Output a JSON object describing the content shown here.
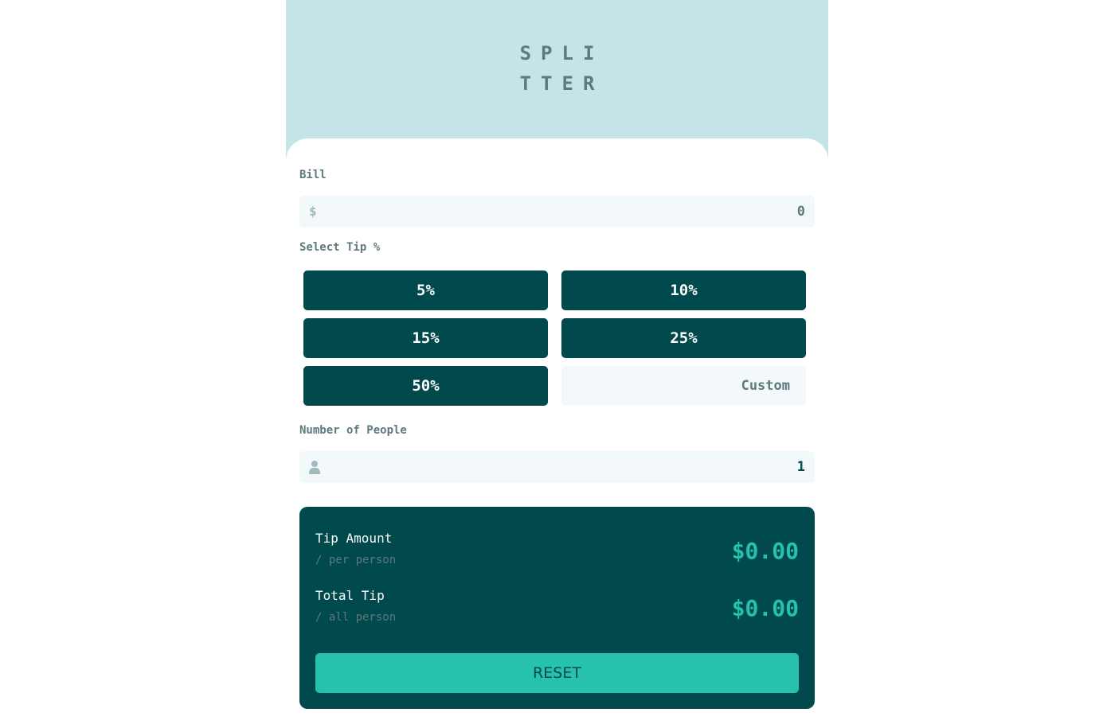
{
  "logo": {
    "line1": "SPLI",
    "line2": "TTER"
  },
  "bill": {
    "label": "Bill",
    "currency_icon": "$",
    "value": "0"
  },
  "tip": {
    "label": "Select Tip %",
    "options": [
      "5%",
      "10%",
      "15%",
      "25%",
      "50%"
    ],
    "custom_placeholder": "Custom"
  },
  "people": {
    "label": "Number of People",
    "icon": "person-icon",
    "value": "1"
  },
  "results": {
    "tip_amount_title": "Tip Amount",
    "tip_amount_sub": "/ per person",
    "tip_amount_value": "$0.00",
    "total_title": "Total Tip",
    "total_sub": "/ all person",
    "total_value": "$0.00",
    "reset_label": "RESET"
  },
  "colors": {
    "background": "#c5e4e7",
    "dark_cyan": "#00494d",
    "strong_cyan": "#26c2ae",
    "input_bg": "#f3f9fa",
    "label_gray": "#5e7a7d"
  }
}
